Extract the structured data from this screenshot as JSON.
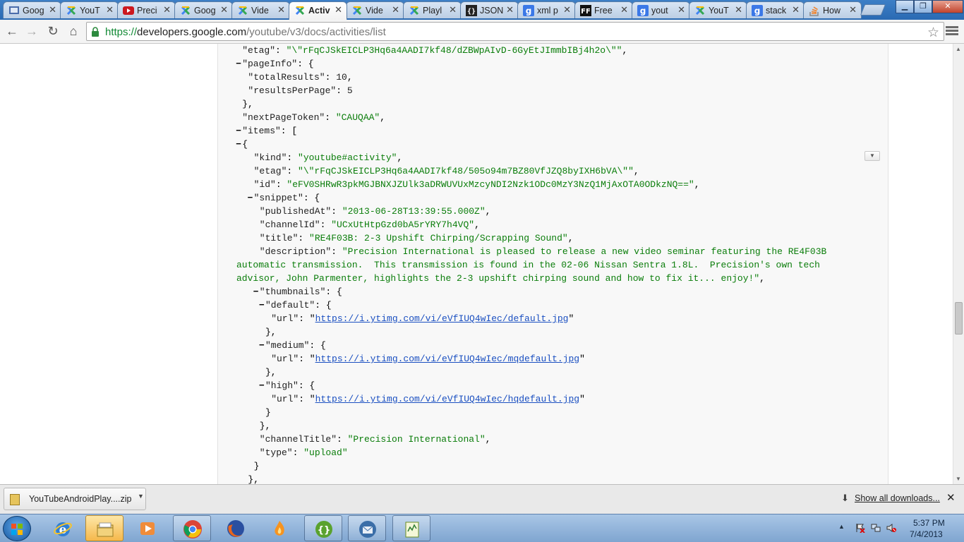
{
  "browser": {
    "tabs": [
      {
        "title": "Goog",
        "favicon": "drive-icon"
      },
      {
        "title": "YouT",
        "favicon": "chrome-apps-icon"
      },
      {
        "title": "Preci",
        "favicon": "youtube-icon"
      },
      {
        "title": "Goog",
        "favicon": "chrome-apps-icon"
      },
      {
        "title": "Vide",
        "favicon": "chrome-apps-icon"
      },
      {
        "title": "Activ",
        "favicon": "chrome-apps-icon",
        "active": true
      },
      {
        "title": "Vide",
        "favicon": "chrome-apps-icon"
      },
      {
        "title": "Playl",
        "favicon": "chrome-apps-icon"
      },
      {
        "title": "JSON",
        "favicon": "braces-icon"
      },
      {
        "title": "xml p",
        "favicon": "google-search-icon"
      },
      {
        "title": "Free",
        "favicon": "ff-icon"
      },
      {
        "title": "yout",
        "favicon": "google-search-icon"
      },
      {
        "title": "YouT",
        "favicon": "chrome-apps-icon"
      },
      {
        "title": "stack",
        "favicon": "google-search-icon"
      },
      {
        "title": "How",
        "favicon": "stackoverflow-icon"
      }
    ],
    "close_glyph": "✕",
    "url_scheme": "https://",
    "url_host": "developers.google.com",
    "url_path": "/youtube/v3/docs/activities/list",
    "star_glyph": "☆",
    "nav": {
      "back": "←",
      "forward": "→",
      "reload": "↻",
      "home": "⌂"
    },
    "window_buttons": {
      "minimize": "▁",
      "restore": "❐",
      "close": "✕"
    }
  },
  "json_lines": [
    {
      "indent": 1,
      "toggle": false,
      "parts": [
        [
          "key",
          "\"etag\""
        ],
        [
          "p",
          ": "
        ],
        [
          "str",
          "\"\\\"rFqCJSkEICLP3Hq6a4AADI7kf48/dZBWpAIvD-6GyEtJImmbIBj4h2o\\\"\""
        ],
        [
          "p",
          ","
        ]
      ]
    },
    {
      "indent": 1,
      "toggle": true,
      "parts": [
        [
          "key",
          "\"pageInfo\""
        ],
        [
          "p",
          ": {"
        ]
      ]
    },
    {
      "indent": 2,
      "toggle": false,
      "parts": [
        [
          "key",
          "\"totalResults\""
        ],
        [
          "p",
          ": "
        ],
        [
          "num",
          "10"
        ],
        [
          "p",
          ","
        ]
      ]
    },
    {
      "indent": 2,
      "toggle": false,
      "parts": [
        [
          "key",
          "\"resultsPerPage\""
        ],
        [
          "p",
          ": "
        ],
        [
          "num",
          "5"
        ]
      ]
    },
    {
      "indent": 1,
      "toggle": false,
      "parts": [
        [
          "p",
          "},"
        ]
      ]
    },
    {
      "indent": 1,
      "toggle": false,
      "parts": [
        [
          "key",
          "\"nextPageToken\""
        ],
        [
          "p",
          ": "
        ],
        [
          "str",
          "\"CAUQAA\""
        ],
        [
          "p",
          ","
        ]
      ]
    },
    {
      "indent": 1,
      "toggle": true,
      "parts": [
        [
          "key",
          "\"items\""
        ],
        [
          "p",
          ": ["
        ]
      ]
    },
    {
      "indent": 1,
      "toggle": true,
      "parts": [
        [
          "p",
          "{"
        ]
      ]
    },
    {
      "indent": 3,
      "toggle": false,
      "parts": [
        [
          "key",
          "\"kind\""
        ],
        [
          "p",
          ": "
        ],
        [
          "str",
          "\"youtube#activity\""
        ],
        [
          "p",
          ","
        ]
      ]
    },
    {
      "indent": 3,
      "toggle": false,
      "parts": [
        [
          "key",
          "\"etag\""
        ],
        [
          "p",
          ": "
        ],
        [
          "str",
          "\"\\\"rFqCJSkEICLP3Hq6a4AADI7kf48/505o94m7BZ80VfJZQ8byIXH6bVA\\\"\""
        ],
        [
          "p",
          ","
        ]
      ]
    },
    {
      "indent": 3,
      "toggle": false,
      "parts": [
        [
          "key",
          "\"id\""
        ],
        [
          "p",
          ": "
        ],
        [
          "str",
          "\"eFV0SHRwR3pkMGJBNXJZUlk3aDRWUVUxMzcyNDI2Nzk1ODc0MzY3NzQ1MjAxOTA0ODkzNQ==\""
        ],
        [
          "p",
          ","
        ]
      ]
    },
    {
      "indent": 3,
      "toggle": true,
      "parts": [
        [
          "key",
          "\"snippet\""
        ],
        [
          "p",
          ": {"
        ]
      ]
    },
    {
      "indent": 4,
      "toggle": false,
      "parts": [
        [
          "key",
          "\"publishedAt\""
        ],
        [
          "p",
          ": "
        ],
        [
          "str",
          "\"2013-06-28T13:39:55.000Z\""
        ],
        [
          "p",
          ","
        ]
      ]
    },
    {
      "indent": 4,
      "toggle": false,
      "parts": [
        [
          "key",
          "\"channelId\""
        ],
        [
          "p",
          ": "
        ],
        [
          "str",
          "\"UCxUtHtpGzd0bA5rYRY7h4VQ\""
        ],
        [
          "p",
          ","
        ]
      ]
    },
    {
      "indent": 4,
      "toggle": false,
      "parts": [
        [
          "key",
          "\"title\""
        ],
        [
          "p",
          ": "
        ],
        [
          "str",
          "\"RE4F03B: 2-3 Upshift Chirping/Scrapping Sound\""
        ],
        [
          "p",
          ","
        ]
      ]
    },
    {
      "indent": 4,
      "toggle": false,
      "parts": [
        [
          "key",
          "\"description\""
        ],
        [
          "p",
          ": "
        ],
        [
          "str",
          "\"Precision International is pleased to release a new video seminar featuring the RE4F03B"
        ]
      ]
    },
    {
      "indent": 0,
      "toggle": false,
      "parts": [
        [
          "str",
          "automatic transmission.  This transmission is found in the 02-06 Nissan Sentra 1.8L.  Precision's own tech"
        ]
      ]
    },
    {
      "indent": 0,
      "toggle": false,
      "parts": [
        [
          "str",
          "advisor, John Parmenter, highlights the 2-3 upshift chirping sound and how to fix it... enjoy!\""
        ],
        [
          "p",
          ","
        ]
      ]
    },
    {
      "indent": 4,
      "toggle": true,
      "parts": [
        [
          "key",
          "\"thumbnails\""
        ],
        [
          "p",
          ": {"
        ]
      ]
    },
    {
      "indent": 5,
      "toggle": true,
      "parts": [
        [
          "key",
          "\"default\""
        ],
        [
          "p",
          ": {"
        ]
      ]
    },
    {
      "indent": 6,
      "toggle": false,
      "parts": [
        [
          "key",
          "\"url\""
        ],
        [
          "p",
          ": \""
        ],
        [
          "lnk",
          "https://i.ytimg.com/vi/eVfIUQ4wIec/default.jpg"
        ],
        [
          "p",
          "\""
        ]
      ]
    },
    {
      "indent": 5,
      "toggle": false,
      "parts": [
        [
          "p",
          "},"
        ]
      ]
    },
    {
      "indent": 5,
      "toggle": true,
      "parts": [
        [
          "key",
          "\"medium\""
        ],
        [
          "p",
          ": {"
        ]
      ]
    },
    {
      "indent": 6,
      "toggle": false,
      "parts": [
        [
          "key",
          "\"url\""
        ],
        [
          "p",
          ": \""
        ],
        [
          "lnk",
          "https://i.ytimg.com/vi/eVfIUQ4wIec/mqdefault.jpg"
        ],
        [
          "p",
          "\""
        ]
      ]
    },
    {
      "indent": 5,
      "toggle": false,
      "parts": [
        [
          "p",
          "},"
        ]
      ]
    },
    {
      "indent": 5,
      "toggle": true,
      "parts": [
        [
          "key",
          "\"high\""
        ],
        [
          "p",
          ": {"
        ]
      ]
    },
    {
      "indent": 6,
      "toggle": false,
      "parts": [
        [
          "key",
          "\"url\""
        ],
        [
          "p",
          ": \""
        ],
        [
          "lnk",
          "https://i.ytimg.com/vi/eVfIUQ4wIec/hqdefault.jpg"
        ],
        [
          "p",
          "\""
        ]
      ]
    },
    {
      "indent": 5,
      "toggle": false,
      "parts": [
        [
          "p",
          "}"
        ]
      ]
    },
    {
      "indent": 4,
      "toggle": false,
      "parts": [
        [
          "p",
          "},"
        ]
      ]
    },
    {
      "indent": 4,
      "toggle": false,
      "parts": [
        [
          "key",
          "\"channelTitle\""
        ],
        [
          "p",
          ": "
        ],
        [
          "str",
          "\"Precision International\""
        ],
        [
          "p",
          ","
        ]
      ]
    },
    {
      "indent": 4,
      "toggle": false,
      "parts": [
        [
          "key",
          "\"type\""
        ],
        [
          "p",
          ": "
        ],
        [
          "str",
          "\"upload\""
        ]
      ]
    },
    {
      "indent": 3,
      "toggle": false,
      "parts": [
        [
          "p",
          "}"
        ]
      ]
    },
    {
      "indent": 2,
      "toggle": false,
      "parts": [
        [
          "p",
          "},"
        ]
      ]
    }
  ],
  "download_bar": {
    "file_name": "YouTubeAndroidPlay....zip",
    "show_all": "Show all downloads...",
    "close_glyph": "✕"
  },
  "taskbar": {
    "apps": [
      "internet-explorer-icon",
      "windows-explorer-icon",
      "media-player-icon",
      "chrome-icon",
      "firefox-icon",
      "burn-icon",
      "json-editor-icon",
      "thunderbird-icon",
      "notepad-icon"
    ],
    "time": "5:37 PM",
    "date": "7/4/2013"
  },
  "colors": {
    "string": "#0a7d0a",
    "link": "#1a4fc1",
    "url_scheme": "#138a36",
    "taskbar": "#7fa5d0"
  }
}
